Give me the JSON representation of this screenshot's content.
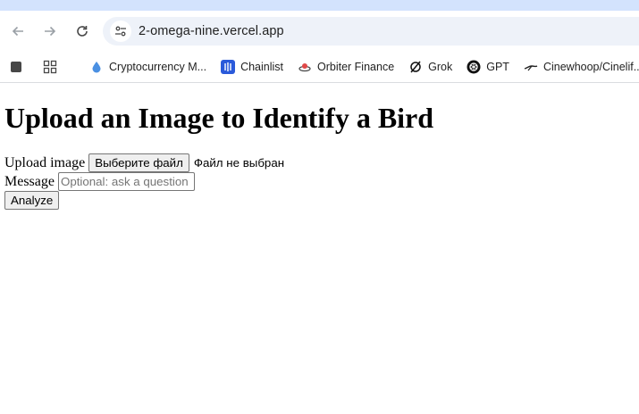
{
  "browser": {
    "url": "2-omega-nine.vercel.app",
    "bookmarks": [
      {
        "label": "Cryptocurrency M...",
        "icon": "droplet-icon"
      },
      {
        "label": "Chainlist",
        "icon": "chainlist-icon"
      },
      {
        "label": "Orbiter Finance",
        "icon": "orbiter-icon"
      },
      {
        "label": "Grok",
        "icon": "grok-icon"
      },
      {
        "label": "GPT",
        "icon": "openai-icon"
      },
      {
        "label": "Cinewhoop/Cinelif...",
        "icon": "drone-icon"
      }
    ]
  },
  "page": {
    "title": "Upload an Image to Identify a Bird",
    "upload_label": "Upload image",
    "file_button": "Выберите файл",
    "file_status": "Файл не выбран",
    "message_label": "Message",
    "message_placeholder": "Optional: ask a question",
    "analyze_button": "Analyze"
  }
}
